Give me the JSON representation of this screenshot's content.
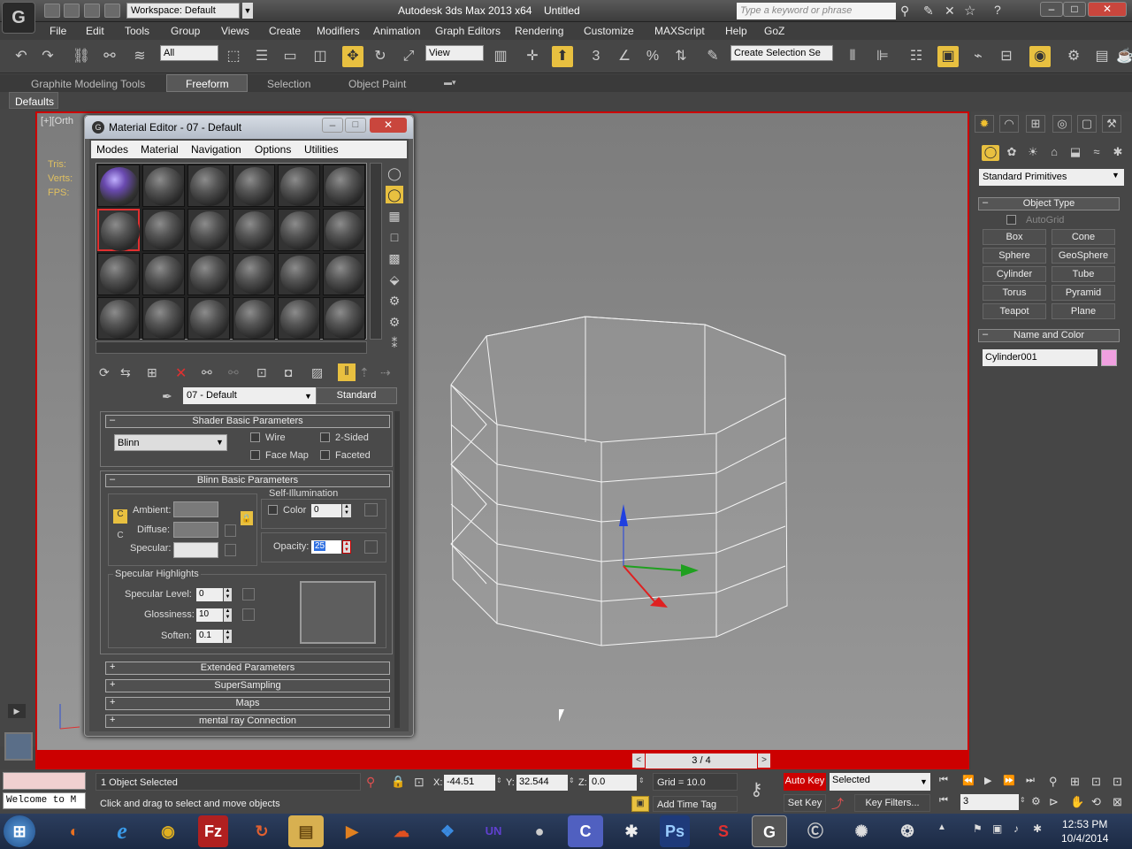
{
  "titlebar": {
    "workspace": "Workspace: Default",
    "app_title": "Autodesk 3ds Max  2013 x64",
    "doc_name": "Untitled",
    "search_placeholder": "Type a keyword or phrase"
  },
  "menus": [
    "File",
    "Edit",
    "Tools",
    "Group",
    "Views",
    "Create",
    "Modifiers",
    "Animation",
    "Graph Editors",
    "Rendering",
    "Customize",
    "MAXScript",
    "Help",
    "GoZ"
  ],
  "toolbar": {
    "filter": "All",
    "refcoord": "View",
    "selset": "Create Selection Se"
  },
  "ribbon": {
    "tabs": [
      "Graphite Modeling Tools",
      "Freeform",
      "Selection",
      "Object Paint"
    ],
    "defaults": "Defaults"
  },
  "viewport": {
    "label": "[+][Orth",
    "stats": [
      "Tris:",
      "Verts:",
      "",
      "FPS:"
    ]
  },
  "command_panel": {
    "category": "Standard Primitives",
    "object_type_title": "Object Type",
    "autogrid": "AutoGrid",
    "buttons": [
      "Box",
      "Cone",
      "Sphere",
      "GeoSphere",
      "Cylinder",
      "Tube",
      "Torus",
      "Pyramid",
      "Teapot",
      "Plane"
    ],
    "name_color_title": "Name and Color",
    "object_name": "Cylinder001",
    "object_color": "#f0a0e0"
  },
  "material_editor": {
    "title": "Material Editor - 07 - Default",
    "menu": [
      "Modes",
      "Material",
      "Navigation",
      "Options",
      "Utilities"
    ],
    "material_name": "07 - Default",
    "material_type": "Standard",
    "shader_rollout": "Shader Basic Parameters",
    "shader": "Blinn",
    "wire": "Wire",
    "two_sided": "2-Sided",
    "face_map": "Face Map",
    "faceted": "Faceted",
    "blinn_rollout": "Blinn Basic Parameters",
    "self_illum": "Self-Illumination",
    "color_label": "Color",
    "color_value": "0",
    "ambient": "Ambient:",
    "diffuse": "Diffuse:",
    "specular": "Specular:",
    "opacity_label": "Opacity:",
    "opacity_value": "25",
    "spec_highlights": "Specular Highlights",
    "spec_level_label": "Specular Level:",
    "spec_level": "0",
    "gloss_label": "Glossiness:",
    "gloss": "10",
    "soften_label": "Soften:",
    "soften": "0.1",
    "rollups": [
      "Extended Parameters",
      "SuperSampling",
      "Maps",
      "mental ray Connection"
    ]
  },
  "status": {
    "frame": "3 / 4",
    "selected": "1 Object Selected",
    "prompt": "Click and drag to select and move objects",
    "x_label": "X:",
    "x": "-44.51",
    "y_label": "Y:",
    "y": "32.544",
    "z_label": "Z:",
    "z": "0.0",
    "grid": "Grid = 10.0",
    "add_time_tag": "Add Time Tag",
    "auto_key": "Auto Key",
    "selected_dd": "Selected",
    "set_key": "Set Key",
    "key_filters": "Key Filters...",
    "frame_field": "3",
    "listener": "Welcome to M"
  },
  "clock": {
    "time": "12:53 PM",
    "date": "10/4/2014"
  }
}
